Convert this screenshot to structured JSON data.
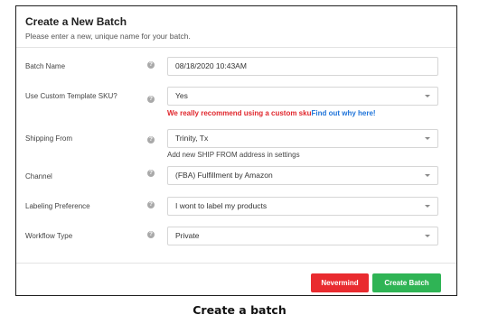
{
  "dialog": {
    "title": "Create a New Batch",
    "subtitle": "Please enter a new, unique name for your batch."
  },
  "fields": {
    "batch_name": {
      "label": "Batch Name",
      "value": "08/18/2020 10:43AM"
    },
    "custom_sku": {
      "label": "Use Custom Template SKU?",
      "value": "Yes",
      "warning": "We really recommend using a custom sku",
      "link": "Find out why here!"
    },
    "shipping_from": {
      "label": "Shipping From",
      "value": "Trinity, Tx",
      "hint": "Add new SHIP FROM address in settings"
    },
    "channel": {
      "label": "Channel",
      "value": "(FBA) Fulfillment by Amazon"
    },
    "labeling": {
      "label": "Labeling Preference",
      "value": "I wont to label my products"
    },
    "workflow": {
      "label": "Workflow Type",
      "value": "Private"
    }
  },
  "help_glyph": "?",
  "buttons": {
    "cancel": "Nevermind",
    "create": "Create Batch"
  },
  "caption": "Create a batch",
  "colors": {
    "cancel": "#e92b2f",
    "create": "#2fb455",
    "warning": "#e0262c",
    "link": "#1e73d9"
  },
  "icons": {
    "help": "question-circle-icon",
    "dropdown": "chevron-down-icon"
  }
}
